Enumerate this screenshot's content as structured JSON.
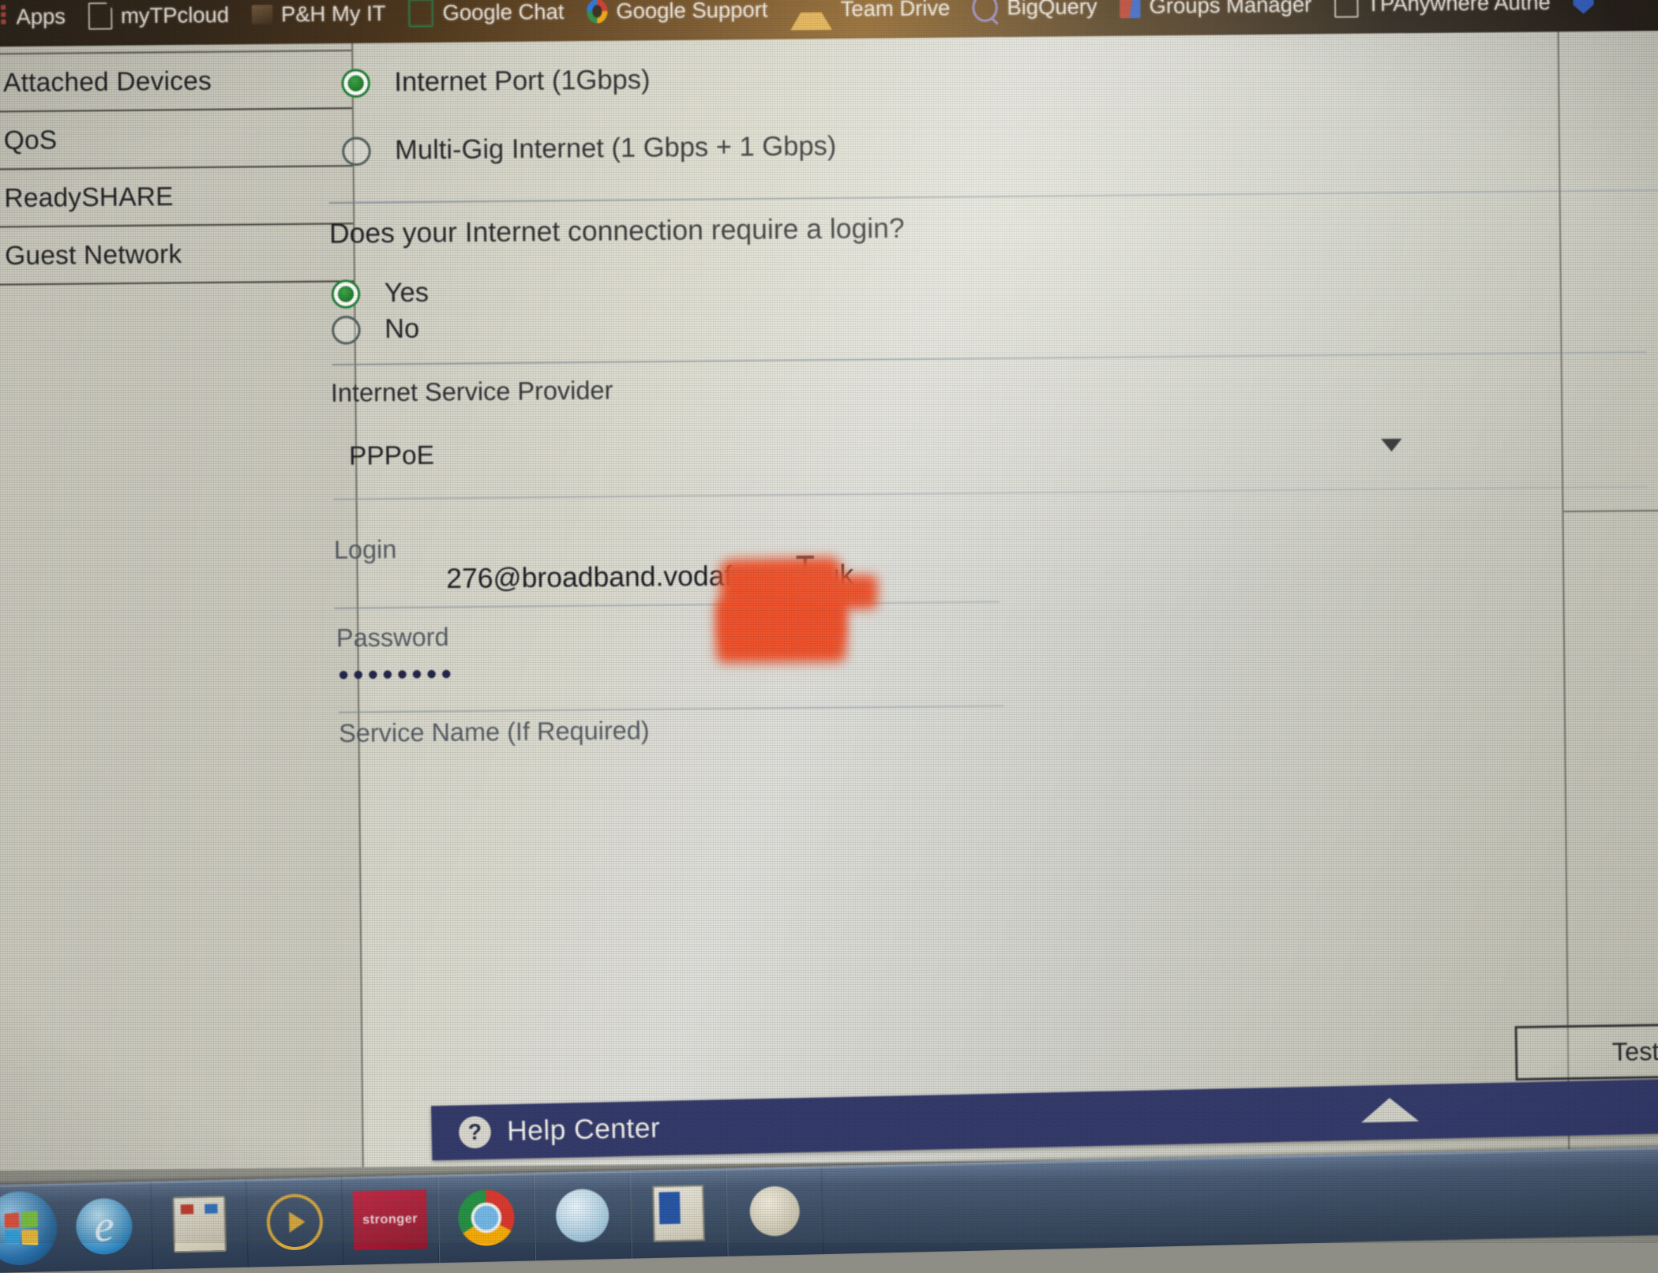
{
  "browser": {
    "bookmarks": [
      {
        "label": "Apps",
        "icon": "apps-grid-icon"
      },
      {
        "label": "myTPcloud",
        "icon": "document-icon"
      },
      {
        "label": "P&H My IT",
        "icon": "image-icon"
      },
      {
        "label": "Google Chat",
        "icon": "chat-bubble-icon"
      },
      {
        "label": "Google Support",
        "icon": "google-g-icon"
      },
      {
        "label": "Team Drive",
        "icon": "drive-triangle-icon"
      },
      {
        "label": "BigQuery",
        "icon": "bigquery-magnifier-icon"
      },
      {
        "label": "Groups Manager",
        "icon": "groups-manager-icon"
      },
      {
        "label": "TPAnywhere Authe",
        "icon": "document-icon"
      },
      {
        "label": "",
        "icon": "shield-icon"
      }
    ]
  },
  "sidebar": {
    "items": [
      {
        "label": "Attached Devices"
      },
      {
        "label": "QoS"
      },
      {
        "label": "ReadySHARE"
      },
      {
        "label": "Guest Network"
      }
    ]
  },
  "main": {
    "wan_preference": {
      "options": [
        {
          "label": "Internet Port (1Gbps)",
          "selected": true
        },
        {
          "label": "Multi-Gig Internet (1 Gbps + 1 Gbps)",
          "selected": false
        }
      ]
    },
    "login_question": {
      "question": "Does your Internet connection require a login?",
      "options": [
        {
          "label": "Yes",
          "selected": true
        },
        {
          "label": "No",
          "selected": false
        }
      ]
    },
    "isp": {
      "label": "Internet Service Provider",
      "value": "PPPoE",
      "caret": "chevron-down-icon"
    },
    "login_field": {
      "label": "Login",
      "value": "276@broadband.vodafone.co.uk",
      "redacted": true
    },
    "password_field": {
      "label": "Password",
      "value": "••••••••"
    },
    "service_name_field": {
      "label": "Service Name (If Required)",
      "value": ""
    },
    "test_button": {
      "label": "Test"
    }
  },
  "help_bar": {
    "icon": "question-mark-icon",
    "label": "Help Center",
    "collapse_icon": "chevron-up-icon"
  },
  "taskbar": {
    "start": {
      "icon": "windows-start-orb"
    },
    "items": [
      {
        "icon": "internet-explorer-icon",
        "label": ""
      },
      {
        "icon": "file-explorer-icon",
        "label": ""
      },
      {
        "icon": "media-player-icon",
        "label": ""
      },
      {
        "icon": "stronger-tile-icon",
        "label": "stronger"
      },
      {
        "icon": "chrome-icon",
        "label": ""
      },
      {
        "icon": "skype-icon",
        "label": ""
      },
      {
        "icon": "outlook-icon",
        "label": ""
      },
      {
        "icon": "generic-app-icon",
        "label": ""
      }
    ]
  },
  "colors": {
    "bookmark_bar": "#2b1e12",
    "page_bg": "#cfcec4",
    "help_bar": "#2b3164",
    "radio_selected": "#1a7a2e",
    "censor": "#ef4a23",
    "taskbar": "#41536e"
  }
}
